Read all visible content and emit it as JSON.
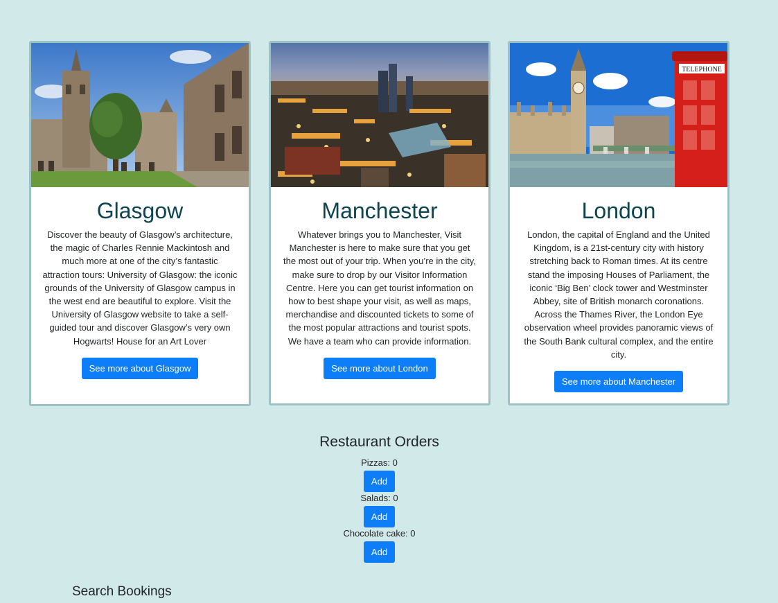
{
  "cards": [
    {
      "title": "Glasgow",
      "text": "Discover the beauty of Glasgow’s architecture, the magic of Charles Rennie Mackintosh and much more at one of the city’s fantastic attraction tours: University of Glasgow: the iconic grounds of the University of Glasgow campus in the west end are beautiful to explore. Visit the University of Glasgow website to take a self-guided tour and discover Glasgow’s very own Hogwarts! House for an Art Lover",
      "button": "See more about Glasgow",
      "image": "glasgow-university-photo"
    },
    {
      "title": "Manchester",
      "text": "Whatever brings you to Manchester, Visit Manchester is here to make sure that you get the most out of your trip. When you’re in the city, make sure to drop by our Visitor Information Centre. Here you can get tourist information on how to best shape your visit, as well as maps, merchandise and discounted tickets to some of the most popular attractions and tourist spots. We have a team who can provide information.",
      "button": "See more about London",
      "image": "manchester-night-skyline-photo"
    },
    {
      "title": "London",
      "text": "London, the capital of England and the United Kingdom, is a 21st-century city with history stretching back to Roman times. At its centre stand the imposing Houses of Parliament, the iconic ‘Big Ben’ clock tower and Westminster Abbey, site of British monarch coronations. Across the Thames River, the London Eye observation wheel provides panoramic views of the South Bank cultural complex, and the entire city.",
      "button": "See more about Manchester",
      "image": "london-big-ben-phone-box-photo",
      "phone_box_sign": "TELEPHONE"
    }
  ],
  "orders": {
    "title": "Restaurant Orders",
    "items": [
      {
        "label": "Pizzas: 0",
        "button": "Add"
      },
      {
        "label": "Salads: 0",
        "button": "Add"
      },
      {
        "label": "Chocolate cake: 0",
        "button": "Add"
      }
    ]
  },
  "search": {
    "title": "Search Bookings"
  },
  "colors": {
    "background": "#d2e9ea",
    "card_border": "#9dc2c5",
    "title": "#0d4450",
    "button": "#0d7ef8"
  }
}
